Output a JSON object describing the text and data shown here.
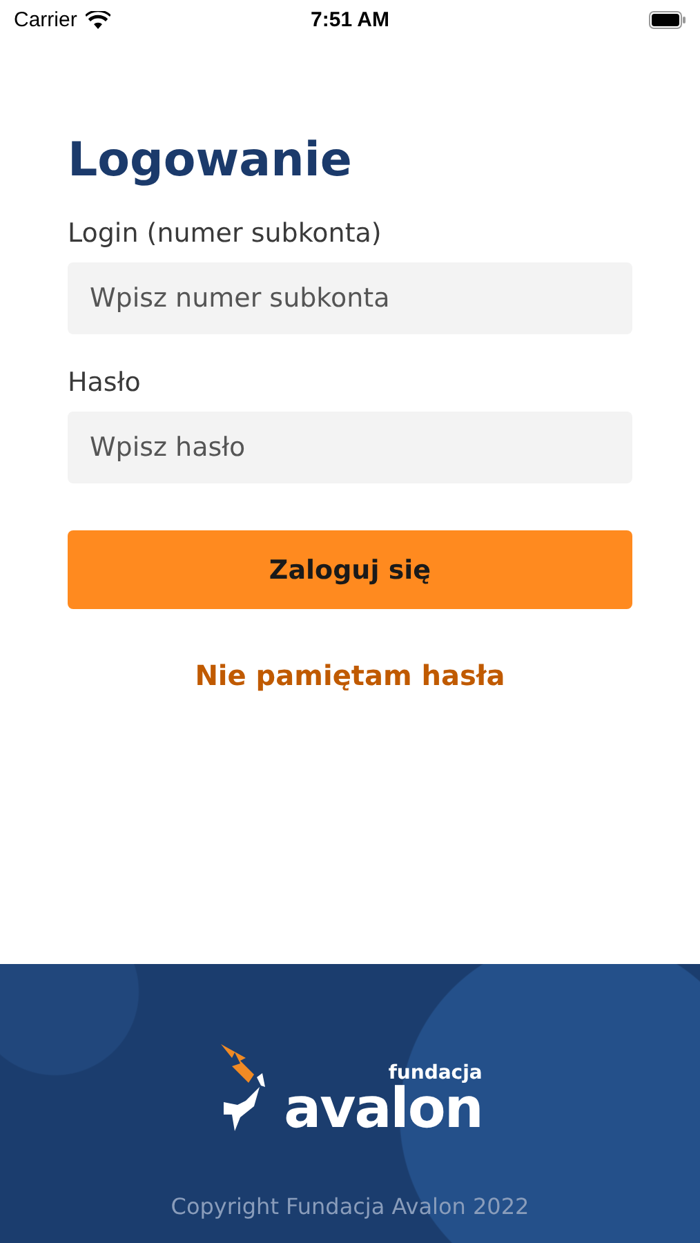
{
  "status_bar": {
    "carrier": "Carrier",
    "time": "7:51 AM"
  },
  "title": "Logowanie",
  "fields": [
    {
      "label": "Login (numer subkonta)",
      "placeholder": "Wpisz numer subkonta"
    },
    {
      "label": "Hasło",
      "placeholder": "Wpisz hasło"
    }
  ],
  "login_button": "Zaloguj się",
  "forgot_link": "Nie pamiętam hasła",
  "footer": {
    "logo_small": "fundacja",
    "logo_big": "avalon",
    "copyright": "Copyright Fundacja Avalon 2022"
  }
}
